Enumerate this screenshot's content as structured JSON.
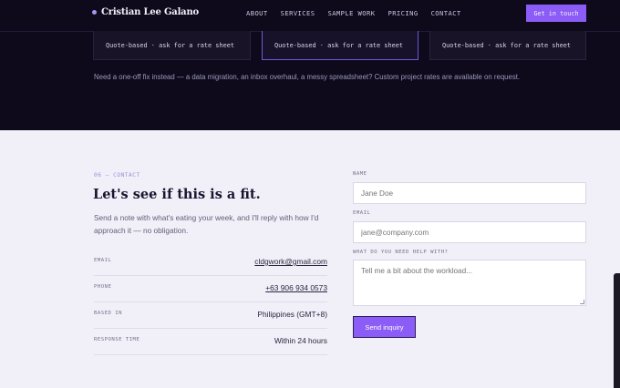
{
  "nav": {
    "brand": "Cristian Lee Galano",
    "links": [
      "ABOUT",
      "SERVICES",
      "SAMPLE WORK",
      "PRICING",
      "CONTACT"
    ],
    "cta": "Get in touch"
  },
  "pricing": {
    "cards": [
      {
        "note": "Quote-based · ask for a rate sheet"
      },
      {
        "note": "Quote-based · ask for a rate sheet"
      },
      {
        "note": "Quote-based · ask for a rate sheet"
      }
    ],
    "custom_note": "Need a one-off fix instead — a data migration, an inbox overhaul, a messy spreadsheet? Custom project rates are available on request."
  },
  "contact": {
    "eyebrow": "06 — CONTACT",
    "title": "Let's see if this is a fit.",
    "intro": "Send a note with what's eating your week, and I'll reply with how I'd approach it — no obligation.",
    "info": [
      {
        "label": "EMAIL",
        "value": "cldgwork@gmail.com"
      },
      {
        "label": "PHONE",
        "value": "+63 906 934 0573"
      },
      {
        "label": "BASED IN",
        "value": "Philippines (GMT+8)"
      },
      {
        "label": "RESPONSE TIME",
        "value": "Within 24 hours"
      }
    ]
  },
  "form": {
    "name_label": "NAME",
    "name_placeholder": "Jane Doe",
    "email_label": "EMAIL",
    "email_placeholder": "jane@company.com",
    "message_label": "WHAT DO YOU NEED HELP WITH?",
    "message_placeholder": "Tell me a bit about the workload...",
    "submit": "Send inquiry"
  },
  "colors": {
    "accent": "#8b5cf6",
    "dark_bg": "#0e0a1c",
    "light_bg": "#f1f0f8"
  }
}
